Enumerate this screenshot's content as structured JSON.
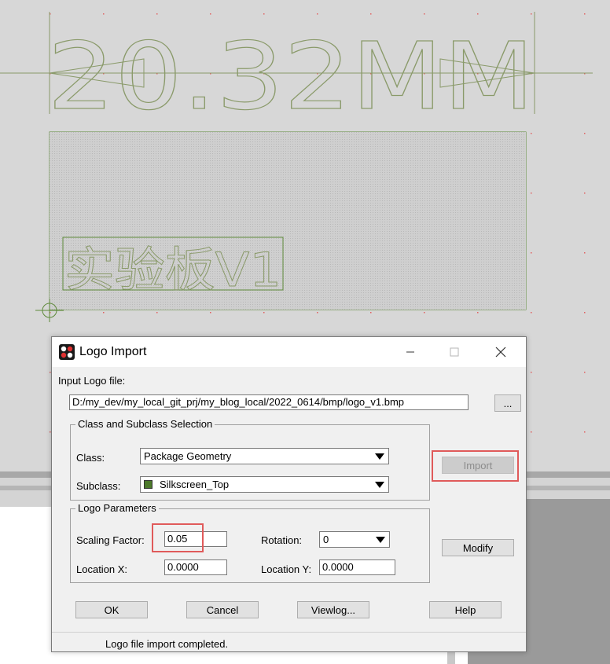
{
  "canvas": {
    "dimension_text": "20.32MM",
    "logo_text": "实验板V1",
    "colors": {
      "background": "#d7d7d7",
      "silk": "#8a9a6a",
      "board_outline": "#5e8a3a",
      "grid_dot": "#e06060"
    }
  },
  "dialog": {
    "title": "Logo Import",
    "icons": {
      "app": "cadence-app-icon",
      "minimize": "minimize-icon",
      "maximize": "maximize-icon",
      "close": "close-icon"
    },
    "input_logo_label": "Input Logo file:",
    "input_logo_value": "D:/my_dev/my_local_git_prj/my_blog_local/2022_0614/bmp/logo_v1.bmp",
    "browse_label": "...",
    "class_group_title": "Class and Subclass Selection",
    "class_label": "Class:",
    "class_value": "Package Geometry",
    "subclass_label": "Subclass:",
    "subclass_value": "Silkscreen_Top",
    "import_label": "Import",
    "logo_params_title": "Logo Parameters",
    "scaling_label": "Scaling Factor:",
    "scaling_value": "0.05",
    "rotation_label": "Rotation:",
    "rotation_value": "0",
    "location_x_label": "Location X:",
    "location_x_value": "0.0000",
    "location_y_label": "Location Y:",
    "location_y_value": "0.0000",
    "modify_label": "Modify",
    "ok_label": "OK",
    "cancel_label": "Cancel",
    "viewlog_label": "Viewlog...",
    "help_label": "Help",
    "status_text": "Logo file import completed.",
    "highlight_color": "#e05a5a"
  }
}
